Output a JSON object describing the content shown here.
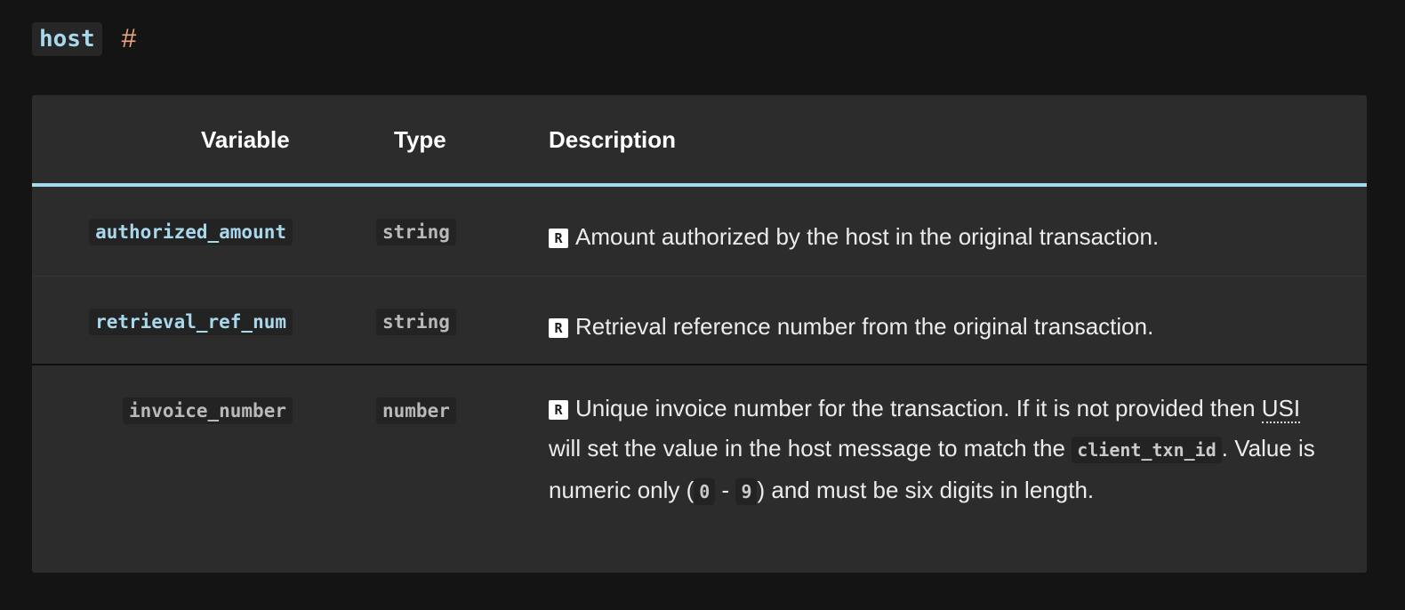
{
  "heading": {
    "name": "host",
    "anchor": "#"
  },
  "table": {
    "columns": {
      "variable": "Variable",
      "type": "Type",
      "description": "Description"
    },
    "rows": [
      {
        "variable": "authorized_amount",
        "type": "string",
        "badge": "R",
        "description": "Amount authorized by the host in the original transaction."
      },
      {
        "variable": "retrieval_ref_num",
        "type": "string",
        "badge": "R",
        "description": "Retrieval reference number from the original transaction."
      },
      {
        "variable": "invoice_number",
        "type": "number",
        "badge": "R",
        "description_parts": {
          "p1": "Unique invoice number for the transaction. If it is not provided then ",
          "abbr": "USI",
          "p2": " will set the value in the host message to match the ",
          "code1": "client_txn_id",
          "p3": ". Value is numeric only (",
          "code2": "0",
          "p4": " - ",
          "code3": "9",
          "p5": ") and must be six digits in length."
        }
      }
    ]
  },
  "colors": {
    "background": "#141414",
    "table_background": "#2c2c2c",
    "header_accent": "#a7dbee",
    "code_highlight": "#a9d8ec",
    "anchor": "#f0a382"
  }
}
